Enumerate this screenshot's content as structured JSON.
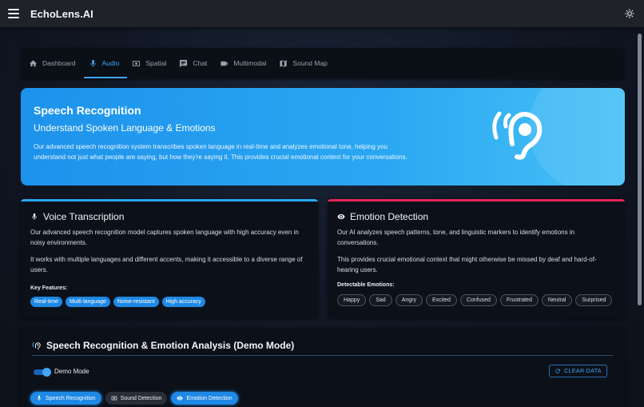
{
  "app": {
    "title": "EchoLens.AI"
  },
  "tabs": [
    {
      "label": "Dashboard",
      "icon": "home-icon",
      "active": false
    },
    {
      "label": "Audio",
      "icon": "mic-icon",
      "active": true
    },
    {
      "label": "Spatial",
      "icon": "spatial-icon",
      "active": false
    },
    {
      "label": "Chat",
      "icon": "chat-icon",
      "active": false
    },
    {
      "label": "Multimodal",
      "icon": "video-icon",
      "active": false
    },
    {
      "label": "Sound Map",
      "icon": "map-icon",
      "active": false
    }
  ],
  "hero": {
    "title": "Speech Recognition",
    "subtitle": "Understand Spoken Language & Emotions",
    "description": "Our advanced speech recognition system transcribes spoken language in real-time and analyzes emotional tone, helping you understand not just what people are saying, but how they're saying it. This provides crucial emotional context for your conversations."
  },
  "voice_card": {
    "title": "Voice Transcription",
    "p1": "Our advanced speech recognition model captures spoken language with high accuracy even in noisy environments.",
    "p2": "It works with multiple languages and different accents, making it accessible to a diverse range of users.",
    "features_label": "Key Features:",
    "features": [
      "Real-time",
      "Multi-language",
      "Noise-resistant",
      "High accuracy"
    ],
    "accent": "#29a8f2"
  },
  "emotion_card": {
    "title": "Emotion Detection",
    "p1": "Our AI analyzes speech patterns, tone, and linguistic markers to identify emotions in conversations.",
    "p2": "This provides crucial emotional context that might otherwise be missed by deaf and hard-of-hearing users.",
    "emotions_label": "Detectable Emotions:",
    "emotions": [
      "Happy",
      "Sad",
      "Angry",
      "Excited",
      "Confused",
      "Frustrated",
      "Neutral",
      "Surprised"
    ],
    "accent": "#e8245a"
  },
  "demo": {
    "title": "Speech Recognition & Emotion Analysis (Demo Mode)",
    "toggle_label": "Demo Mode",
    "toggle_on": true,
    "clear_label": "CLEAR DATA",
    "modes": [
      {
        "label": "Speech Recognition",
        "icon": "mic-icon",
        "active": true
      },
      {
        "label": "Sound Detection",
        "icon": "spatial-icon",
        "active": false
      },
      {
        "label": "Emotion Detection",
        "icon": "eye-icon",
        "active": true
      }
    ]
  }
}
